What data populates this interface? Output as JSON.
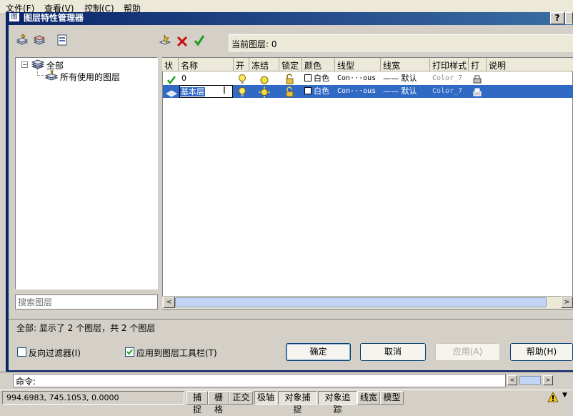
{
  "menubar": {
    "items": [
      "文件(F)",
      "查看(V)",
      "控制(C)",
      "帮助"
    ]
  },
  "dialog": {
    "title": "图层特性管理器",
    "help_glyph": "?",
    "icon_label": "图"
  },
  "toolbar": {
    "current_layer_label": "当前图层: 0"
  },
  "tree": {
    "root": "全部",
    "child": "所有使用的图层",
    "search_placeholder": "搜索图层"
  },
  "list": {
    "columns": [
      "状",
      "名称",
      "开",
      "冻结",
      "锁定",
      "颜色",
      "线型",
      "线宽",
      "打印样式",
      "打",
      "说明"
    ],
    "rows": [
      {
        "name": "0",
        "color": "白色",
        "linetype": "Con···ous",
        "lineweight": "—— 默认",
        "plotstyle": "Color_7",
        "selected": false
      },
      {
        "name": "基本层",
        "color": "白色",
        "linetype": "Con···ous",
        "lineweight": "—— 默认",
        "plotstyle": "Color_7",
        "selected": true
      }
    ],
    "scroll_left": "<",
    "scroll_right": ">"
  },
  "status": {
    "summary": "全部: 显示了 2 个图层，共 2 个图层"
  },
  "options": {
    "invert_filter": "反向过滤器(I)",
    "apply_toolbar": "应用到图层工具栏(T)"
  },
  "buttons": {
    "ok": "确定",
    "cancel": "取消",
    "apply": "应用(A)",
    "help": "帮助(H)"
  },
  "cmd": {
    "label": "命令:"
  },
  "statusbar": {
    "coords": "994.6983,   745.1053,  0.0000",
    "toggles": [
      "捕捉",
      "栅格",
      "正交",
      "极轴",
      "对象捕捉",
      "对象追踪",
      "线宽",
      "模型"
    ]
  },
  "colors": {
    "selection": "#316ac5",
    "titlebar": "#0a246a",
    "ok_check": "#1a9c1a",
    "delete_x": "#c81010"
  }
}
